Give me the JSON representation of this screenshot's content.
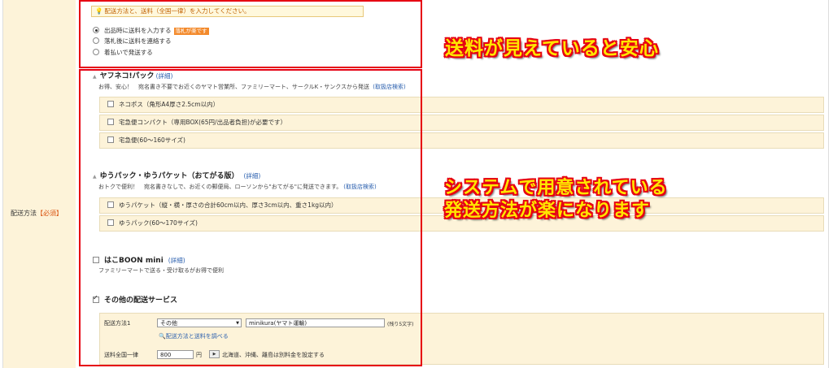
{
  "label": {
    "text": "配送方法",
    "required": "【必須】"
  },
  "notice": "配送方法と、送料（全国一律）を入力してください。",
  "payment_options": [
    {
      "label": "出品時に送料を入力する",
      "badge": "落札が楽です",
      "selected": true
    },
    {
      "label": "落札後に送料を連絡する",
      "selected": false
    },
    {
      "label": "着払いで発送する",
      "selected": false
    }
  ],
  "yafuneko": {
    "title": "ヤフネコ!パック",
    "detail_link": "(詳細)",
    "desc": "お得、安心！　宛名書き不要でお近くのヤマト営業所、ファミリーマート、サークルK・サンクスから発送",
    "store_link": "(取扱店検索)",
    "options": [
      {
        "label": "ネコポス（角形A4厚さ2.5cm以内）"
      },
      {
        "label": "宅急便コンパクト（専用BOX(65円/出品者負担)が必要です）"
      },
      {
        "label": "宅急便(60～160サイズ)"
      }
    ]
  },
  "yupack": {
    "title": "ゆうパック・ゆうパケット（おてがる版）",
    "detail_link": "(詳細)",
    "desc": "おトクで便利！　宛名書きなしで、お近くの郵便局、ローソンから\"おてがる\"に発送できます。",
    "store_link": "(取扱店検索)",
    "options": [
      {
        "label": "ゆうパケット（縦・横・厚さの合計60cm以内、厚さ3cm以内、重さ1kg以内）"
      },
      {
        "label": "ゆうパック(60～170サイズ)"
      }
    ]
  },
  "hakoboon": {
    "title": "はこBOON mini",
    "detail_link": "(詳細)",
    "desc": "ファミリーマートで送る・受け取るがお得で便利"
  },
  "other": {
    "title": "その他の配送サービス",
    "method_label": "配送方法1",
    "method_select": "その他",
    "method_value": "minikura(ヤマト運輸)",
    "remaining": "(残り5文字)",
    "search_link": "配送方法と送料を調べる",
    "fee_label": "送料全国一律",
    "fee_value": "800",
    "fee_unit": "円",
    "remote_note": "北海道、沖縄、離島は別料金を設定する"
  },
  "captions": {
    "top": "送料が見えていると安心",
    "middle_line1": "システムで用意されている",
    "middle_line2": "発送方法が楽になります"
  },
  "colors": {
    "highlight": "#e60012",
    "caption": "#ffe600",
    "panel": "#fdf3d9",
    "link": "#2a5fae"
  }
}
